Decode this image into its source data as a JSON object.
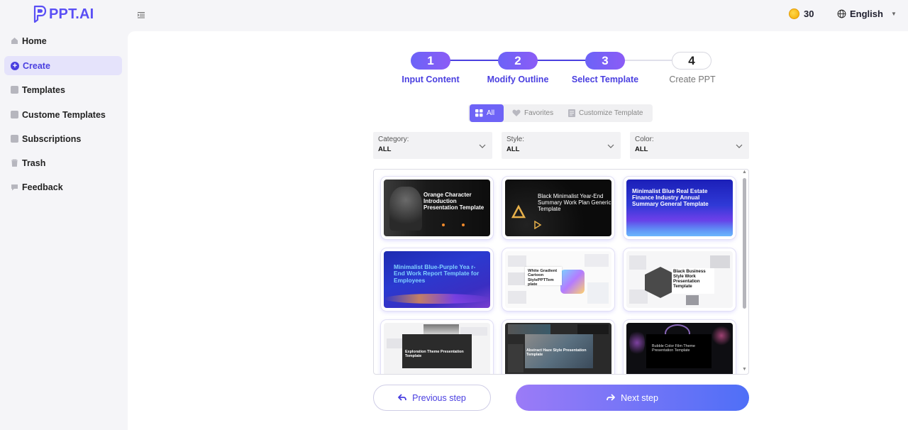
{
  "header": {
    "logo_text": "PPT.AI",
    "coins": "30",
    "language": "English",
    "colors": {
      "brand": "#5a4ff5",
      "accent": "#4a3fe0"
    }
  },
  "sidebar": {
    "items": [
      {
        "label": "Home",
        "icon": "home-icon"
      },
      {
        "label": "Create",
        "icon": "plus-circle-icon",
        "active": true
      },
      {
        "label": "Templates",
        "icon": "templates-icon"
      },
      {
        "label": "Custome Templates",
        "icon": "custom-templates-icon"
      },
      {
        "label": "Subscriptions",
        "icon": "subscriptions-icon"
      },
      {
        "label": "Trash",
        "icon": "trash-icon"
      },
      {
        "label": "Feedback",
        "icon": "feedback-icon"
      }
    ]
  },
  "stepper": {
    "steps": [
      {
        "number": "1",
        "label": "Input Content",
        "state": "done"
      },
      {
        "number": "2",
        "label": "Modify Outline",
        "state": "done"
      },
      {
        "number": "3",
        "label": "Select Template",
        "state": "current"
      },
      {
        "number": "4",
        "label": "Create PPT",
        "state": "pending"
      }
    ]
  },
  "tabs": {
    "items": [
      {
        "label": "All",
        "icon": "grid-icon",
        "active": true
      },
      {
        "label": "Favorites",
        "icon": "heart-icon"
      },
      {
        "label": "Customize Template",
        "icon": "document-icon"
      }
    ]
  },
  "filters": [
    {
      "label": "Category:",
      "value": "ALL"
    },
    {
      "label": "Style:",
      "value": "ALL"
    },
    {
      "label": "Color:",
      "value": "ALL"
    }
  ],
  "templates": [
    {
      "title": "Orange Character Introduction Presentation Template"
    },
    {
      "title": "Black Minimalist Year-End Summary Work Plan Generic Template"
    },
    {
      "title": "Minimalist Blue Real Estate Finance Industry Annual Summary General Template"
    },
    {
      "title": "Minimalist Blue-Purple Yea r-End Work Report Template for Employees"
    },
    {
      "title": "White Gradient Cartoon StylePPTTem plate"
    },
    {
      "title": "Black Business Style Work Presentation Template"
    },
    {
      "title": "Exploration Theme Presentation Template"
    },
    {
      "title": "Abstract Haze Style Presentation Template"
    },
    {
      "title": "Bubble Color Film Theme Presentation Template"
    }
  ],
  "footer": {
    "prev_label": "Previous step",
    "next_label": "Next step"
  }
}
